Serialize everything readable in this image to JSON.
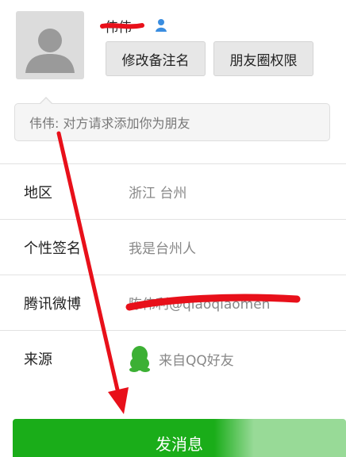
{
  "profile": {
    "nickname": "伟伟",
    "gender_icon": "male-user-icon",
    "remark_button": "修改备注名",
    "permission_button": "朋友圈权限"
  },
  "request_message": "伟伟: 对方请求添加你为朋友",
  "info": {
    "region": {
      "label": "地区",
      "value": "浙江  台州"
    },
    "signature": {
      "label": "个性签名",
      "value": "我是台州人"
    },
    "weibo": {
      "label": "腾讯微博",
      "value": "陈伟利@qiaoqiaomen"
    },
    "source": {
      "label": "来源",
      "value": "来自QQ好友",
      "icon": "qq-penguin-icon"
    }
  },
  "send_button": "发消息",
  "colors": {
    "accent_green": "#1aad19",
    "annotation_red": "#e8101a"
  }
}
